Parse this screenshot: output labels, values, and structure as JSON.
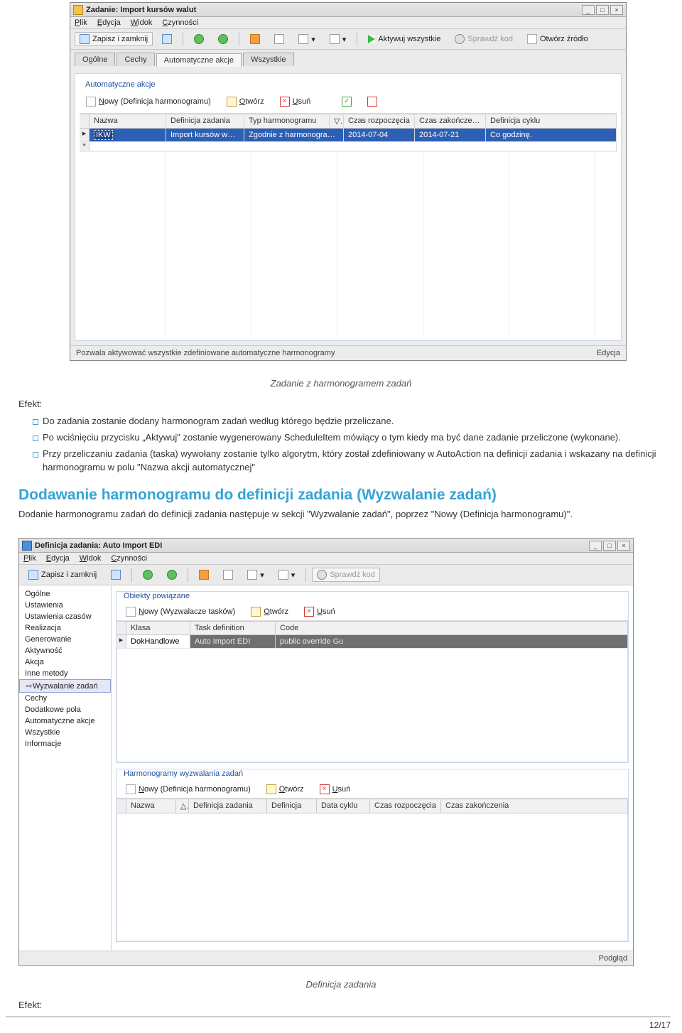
{
  "win1": {
    "title": "Zadanie: Import kursów walut",
    "menu": {
      "plik": "Plik",
      "edycja": "Edycja",
      "widok": "Widok",
      "czynnosci": "Czynności"
    },
    "toolbar": {
      "save_close": "Zapisz i zamknij",
      "activate_all": "Aktywuj wszystkie",
      "check_code": "Sprawdź kod",
      "open_source": "Otwórz źródło"
    },
    "tabs": [
      "Ogólne",
      "Cechy",
      "Automatyczne akcje",
      "Wszystkie"
    ],
    "active_tab": 2,
    "group_title": "Automatyczne akcje",
    "inner_toolbar": {
      "new": "Nowy (Definicja harmonogramu)",
      "open": "Otwórz",
      "delete": "Usuń"
    },
    "grid": {
      "headers": [
        "Nazwa",
        "Definicja zadania",
        "Typ harmonogramu",
        "▽",
        "Czas rozpoczęcia",
        "Czas zakończenia",
        "Definicja cyklu"
      ],
      "row": {
        "nazwa": "IKW",
        "def": "Import kursów walut",
        "typ": "Zgodnie z harmonogram…",
        "start": "2014-07-04",
        "end": "2014-07-21",
        "cycle": "Co godzinę."
      }
    },
    "status_left": "Pozwala aktywować wszystkie zdefiniowane automatyczne harmonogramy",
    "status_right": "Edycja"
  },
  "doc": {
    "caption1": "Zadanie z harmonogramem zadań",
    "effect_label": "Efekt:",
    "bullets": [
      "Do zadania zostanie dodany harmonogram zadań według którego będzie przeliczane.",
      "Po wciśnięciu przycisku „Aktywuj\" zostanie wygenerowany ScheduleItem mówiący o tym kiedy ma być dane zadanie przeliczone (wykonane).",
      "Przy przeliczaniu zadania (taska) wywołany zostanie tylko algorytm, który został zdefiniowany w AutoAction na definicji zadania i wskazany na definicji harmonogramu w polu \"Nazwa akcji automatycznej\""
    ],
    "heading": "Dodawanie harmonogramu do definicji zadania (Wyzwalanie zadań)",
    "para": "Dodanie harmonogramu zadań do definicji zadania następuje w sekcji \"Wyzwalanie zadań\", poprzez \"Nowy (Definicja harmonogramu)\".",
    "caption2": "Definicja zadania",
    "page": "12/17"
  },
  "win2": {
    "title": "Definicja zadania: Auto Import EDI",
    "menu": {
      "plik": "Plik",
      "edycja": "Edycja",
      "widok": "Widok",
      "czynnosci": "Czynności"
    },
    "toolbar": {
      "save_close": "Zapisz i zamknij",
      "check_code": "Sprawdź kod"
    },
    "side_items": [
      "Ogólne",
      "Ustawienia",
      "Ustawienia czasów",
      "Realizacja",
      "Generowanie",
      "Aktywność",
      "Akcja",
      "Inne metody",
      "Wyzwalanie zadań",
      "Cechy",
      "Dodatkowe pola",
      "Automatyczne akcje",
      "Wszystkie",
      "Informacje"
    ],
    "side_selected": 8,
    "group1_title": "Obiekty powiązane",
    "inner_toolbar1": {
      "new": "Nowy (Wyzwalacze tasków)",
      "open": "Otwórz",
      "delete": "Usuń"
    },
    "grid1": {
      "headers": [
        "Klasa",
        "Task definition",
        "Code"
      ],
      "row": {
        "klasa": "DokHandlowe",
        "task": "Auto Import EDI",
        "code": "public override Gu"
      }
    },
    "group2_title": "Harmonogramy wyzwalania zadań",
    "inner_toolbar2": {
      "new": "Nowy (Definicja harmonogramu)",
      "open": "Otwórz",
      "delete": "Usuń"
    },
    "grid2": {
      "headers": [
        "Nazwa",
        "△",
        "Definicja zadania",
        "Definicja",
        "Data cyklu",
        "Czas rozpoczęcia",
        "Czas zakończenia"
      ]
    },
    "status_right": "Podgląd"
  }
}
